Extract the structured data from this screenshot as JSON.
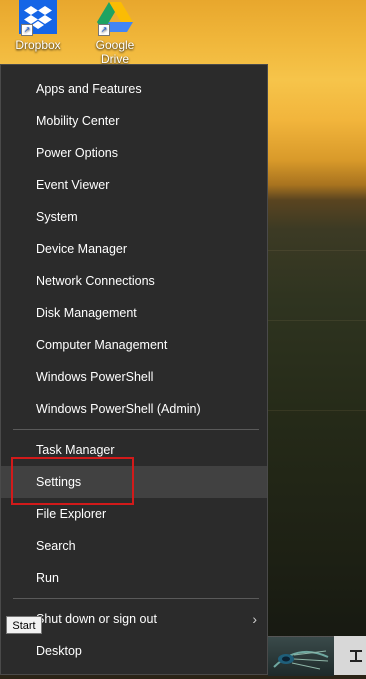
{
  "desktop": {
    "icons": [
      {
        "label": "Dropbox",
        "icon": "dropbox-icon"
      },
      {
        "label": "Google Drive",
        "icon": "google-drive-icon"
      }
    ]
  },
  "menu": {
    "items": [
      {
        "label": "Apps and Features"
      },
      {
        "label": "Mobility Center"
      },
      {
        "label": "Power Options"
      },
      {
        "label": "Event Viewer"
      },
      {
        "label": "System"
      },
      {
        "label": "Device Manager"
      },
      {
        "label": "Network Connections"
      },
      {
        "label": "Disk Management"
      },
      {
        "label": "Computer Management"
      },
      {
        "label": "Windows PowerShell"
      },
      {
        "label": "Windows PowerShell (Admin)"
      },
      {
        "label": "Task Manager"
      },
      {
        "label": "Settings"
      },
      {
        "label": "File Explorer"
      },
      {
        "label": "Search"
      },
      {
        "label": "Run"
      },
      {
        "label": "Shut down or sign out"
      },
      {
        "label": "Desktop"
      }
    ],
    "highlighted": "Settings",
    "highlight_color": "#d21a1a"
  },
  "tooltip": {
    "text": "Start"
  },
  "taskbar": {
    "right_icon": "task-view-icon"
  }
}
